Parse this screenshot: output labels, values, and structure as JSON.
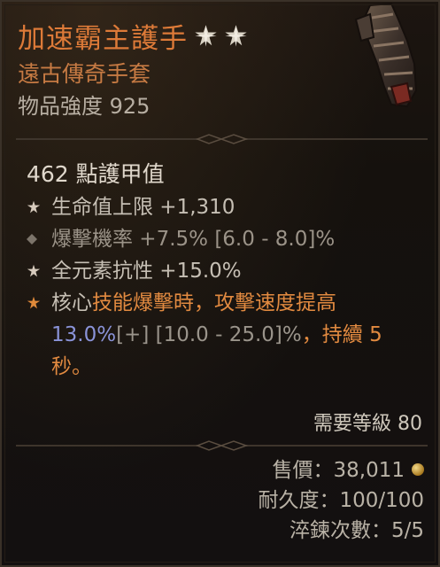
{
  "item": {
    "name": "加速霸主護手",
    "type_line": "遠古傳奇手套",
    "item_power_label": "物品強度",
    "item_power": "925"
  },
  "stats": {
    "armor": "462 點護甲值",
    "affixes": [
      {
        "text": "生命值上限 +1,310",
        "bullet": "star-bullet"
      },
      {
        "text": "爆擊機率 +7.5% [6.0 - 8.0]%",
        "bullet": "diamond-bullet"
      },
      {
        "text": "全元素抗性 +15.0%",
        "bullet": "star-bullet"
      }
    ],
    "aspect": {
      "prefix": "核心",
      "highlight": "技能爆擊時，攻擊速度提高",
      "value": "13.0%",
      "bracket": "[+] [10.0 - 25.0]%",
      "suffix": "，持續 5",
      "suffix2": "秒。"
    }
  },
  "requirement": "需要等級 80",
  "footer": {
    "sell_label": "售價：",
    "sell_value": "38,011",
    "durability_label": "耐久度：",
    "durability_value": "100/100",
    "temper_label": "淬鍊次數：",
    "temper_value": "5/5"
  },
  "colors": {
    "title": "#dd7a38",
    "aspect_highlight": "#e28a40",
    "aspect_value": "#8a93d8",
    "background": "#15110d"
  },
  "icons": [
    "gauntlet-icon",
    "star-icon",
    "diamond-icon",
    "coin-icon"
  ]
}
